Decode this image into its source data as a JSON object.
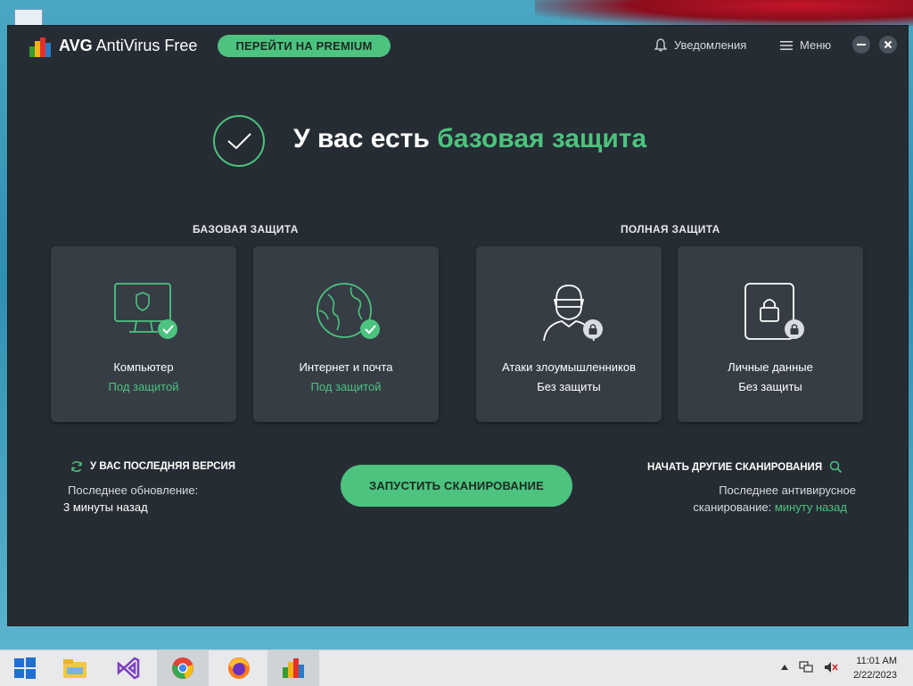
{
  "app": {
    "name_bold": "AVG",
    "name_rest": " AntiVirus Free",
    "premium_button": "ПЕРЕЙТИ НА PREMIUM",
    "notifications": "Уведомления",
    "menu": "Меню"
  },
  "headline": {
    "prefix": "У вас есть ",
    "highlight": "базовая защита"
  },
  "sections": {
    "basic": "БАЗОВАЯ ЗАЩИТА",
    "full": "ПОЛНАЯ ЗАЩИТА"
  },
  "cards": [
    {
      "title": "Компьютер",
      "state": "Под защитой",
      "status": "protected",
      "icon": "monitor-shield-icon"
    },
    {
      "title": "Интернет и почта",
      "state": "Под защитой",
      "status": "protected",
      "icon": "globe-icon"
    },
    {
      "title": "Атаки злоумышленников",
      "state": "Без защиты",
      "status": "locked",
      "icon": "hacker-icon"
    },
    {
      "title": "Личные данные",
      "state": "Без защиты",
      "status": "locked",
      "icon": "padlock-icon"
    }
  ],
  "update": {
    "title": "У ВАС ПОСЛЕДНЯЯ ВЕРСИЯ",
    "line1": "Последнее обновление:",
    "line2": "3 минуты назад"
  },
  "scan_button": "ЗАПУСТИТЬ СКАНИРОВАНИЕ",
  "other_scans": {
    "title": "НАЧАТЬ ДРУГИЕ СКАНИРОВАНИЯ",
    "line1": "Последнее антивирусное",
    "line2_prefix": "сканирование:  ",
    "line2_value": "минуту назад"
  },
  "taskbar": {
    "items": [
      "start-icon",
      "file-explorer-icon",
      "visual-studio-icon",
      "chrome-icon",
      "firefox-icon",
      "avg-icon"
    ],
    "time": "11:01 AM",
    "date": "2/22/2023"
  },
  "colors": {
    "accent": "#4cc37f",
    "window_bg": "#262c33",
    "card_bg": "#363d45"
  }
}
